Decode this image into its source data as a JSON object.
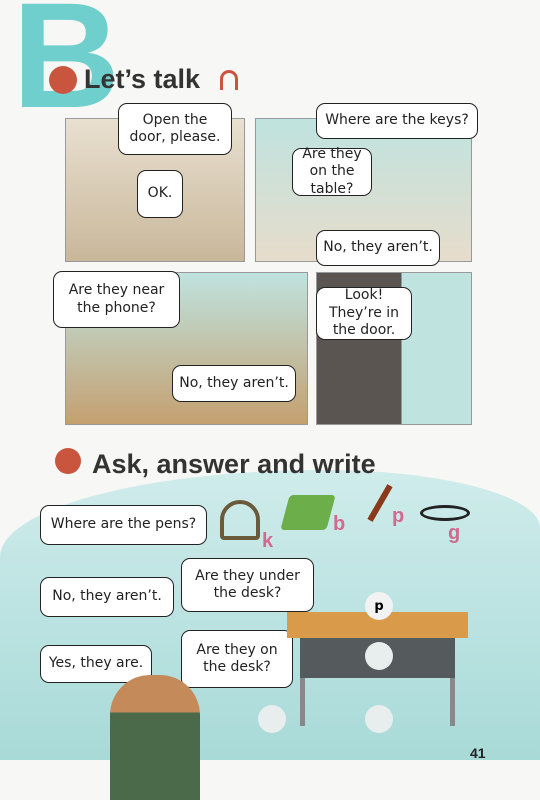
{
  "section_letter": "B",
  "lets_talk": {
    "title": "Let’s talk",
    "bubbles": [
      "Open the door, please.",
      "OK.",
      "Where are the keys?",
      "Are they on the table?",
      "No, they aren’t.",
      "Are they near the phone?",
      "No, they aren’t.",
      "Look! They’re in the door."
    ]
  },
  "ask": {
    "title": "Ask, answer and write",
    "bubbles": [
      "Where are the pens?",
      "No, they aren’t.",
      "Are they under the desk?",
      "Yes, they are.",
      "Are they on the desk?"
    ],
    "items": [
      {
        "icon": "keys-icon",
        "letter": "k"
      },
      {
        "icon": "book-icon",
        "letter": "b"
      },
      {
        "icon": "pens-icon",
        "letter": "p"
      },
      {
        "icon": "glasses-icon",
        "letter": "g"
      }
    ],
    "desk_labels": [
      "p"
    ]
  },
  "page_number": "41"
}
